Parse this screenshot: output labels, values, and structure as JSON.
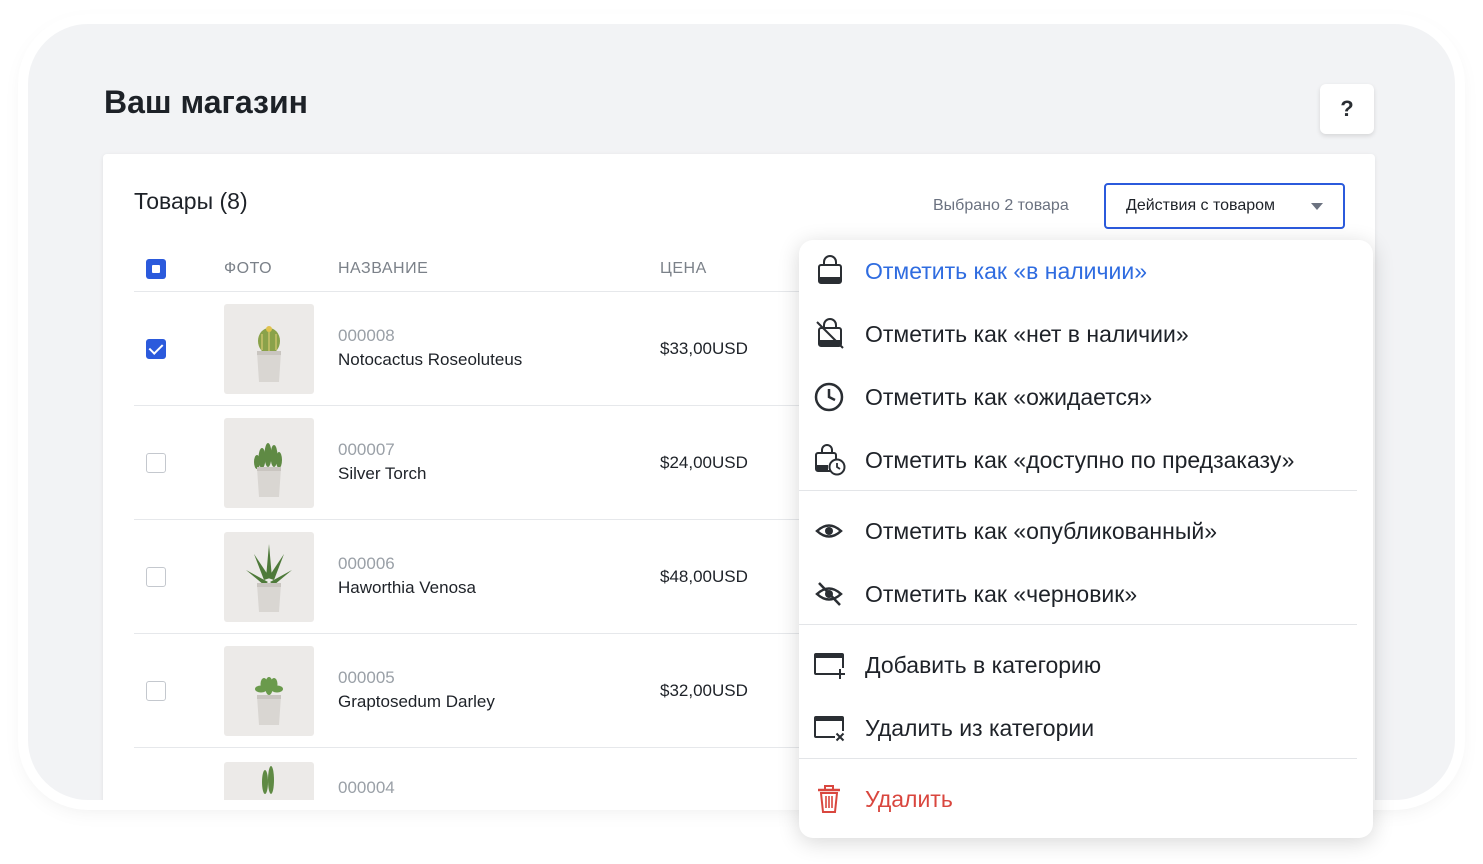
{
  "page": {
    "title": "Ваш магазин",
    "help_label": "?"
  },
  "products": {
    "title": "Товары (8)",
    "selected_text": "Выбрано 2 товара",
    "actions_label": "Действия с товаром",
    "columns": {
      "photo": "ФОТО",
      "name": "НАЗВАНИЕ",
      "price": "ЦЕНА"
    },
    "rows": [
      {
        "sku": "000008",
        "name": "Notocactus Roseoluteus",
        "price": "$33,00USD",
        "checked": true
      },
      {
        "sku": "000007",
        "name": "Silver Torch",
        "price": "$24,00USD",
        "checked": false
      },
      {
        "sku": "000006",
        "name": "Haworthia Venosa",
        "price": "$48,00USD",
        "checked": false
      },
      {
        "sku": "000005",
        "name": "Graptosedum Darley",
        "price": "$32,00USD",
        "checked": false
      },
      {
        "sku": "000004",
        "name": "",
        "price": "",
        "checked": false
      }
    ]
  },
  "menu": {
    "in_stock": "Отметить как «в наличии»",
    "out_of_stock": "Отметить как «нет в наличии»",
    "expected": "Отметить как «ожидается»",
    "preorder": "Отметить как «доступно по предзаказу»",
    "published": "Отметить как «опубликованный»",
    "draft": "Отметить как «черновик»",
    "add_category": "Добавить в категорию",
    "remove_category": "Удалить из категории",
    "delete": "Удалить"
  },
  "colors": {
    "accent": "#2b5adc",
    "link_blue": "#2f6ce0",
    "danger": "#d9463e"
  }
}
